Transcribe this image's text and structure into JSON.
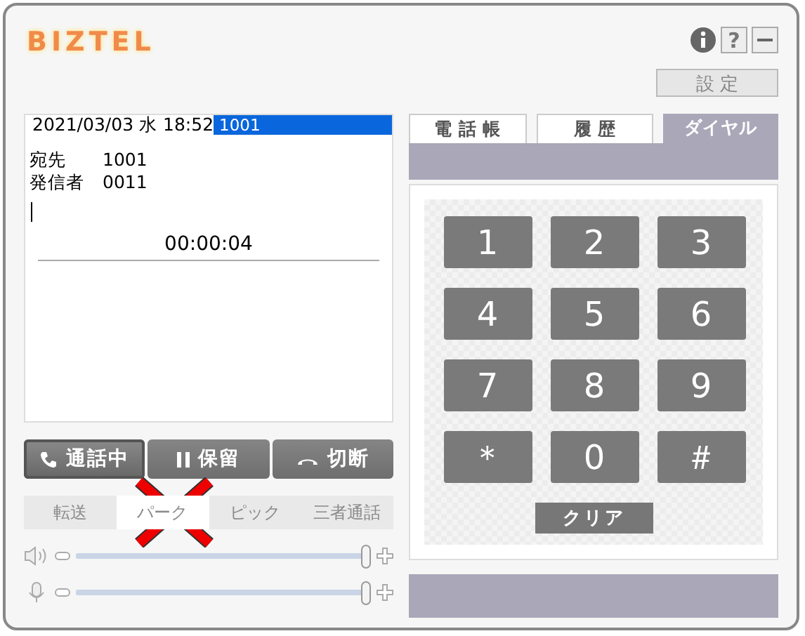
{
  "logo": "BIZTEL",
  "header_buttons": [
    {
      "kind": "info"
    },
    {
      "kind": "help",
      "label": "?"
    },
    {
      "kind": "minimize"
    }
  ],
  "settings_button": "設 定",
  "display": {
    "datetime": "2021/03/03 水 18:52",
    "line": "1001",
    "fields": [
      {
        "label": "宛先",
        "value": "1001"
      },
      {
        "label": "発信者",
        "value": "0011"
      }
    ],
    "timer": "00:00:04"
  },
  "call_buttons": [
    {
      "kind": "phone",
      "label": "通話中",
      "selected": true
    },
    {
      "kind": "hold",
      "label": "保留",
      "selected": false
    },
    {
      "kind": "hangup",
      "label": "切断",
      "selected": false
    }
  ],
  "feature_buttons": [
    {
      "label": "転送",
      "selected": false
    },
    {
      "label": "パーク",
      "selected": true
    },
    {
      "label": "ピック",
      "selected": false
    },
    {
      "label": "三者通話",
      "selected": false
    }
  ],
  "annotation": {
    "kind": "cross"
  },
  "sliders": [
    {
      "kind": "speaker",
      "level": 1
    },
    {
      "kind": "mic",
      "level": 1
    }
  ],
  "tabs": [
    {
      "label": "電 話 帳",
      "selected": false
    },
    {
      "label": "履 歴",
      "selected": false
    },
    {
      "label": "ダイヤル",
      "selected": true
    }
  ],
  "keypad": [
    "1",
    "2",
    "3",
    "4",
    "5",
    "6",
    "7",
    "8",
    "9",
    "＊",
    "0",
    "＃"
  ],
  "clear_button": "クリア"
}
